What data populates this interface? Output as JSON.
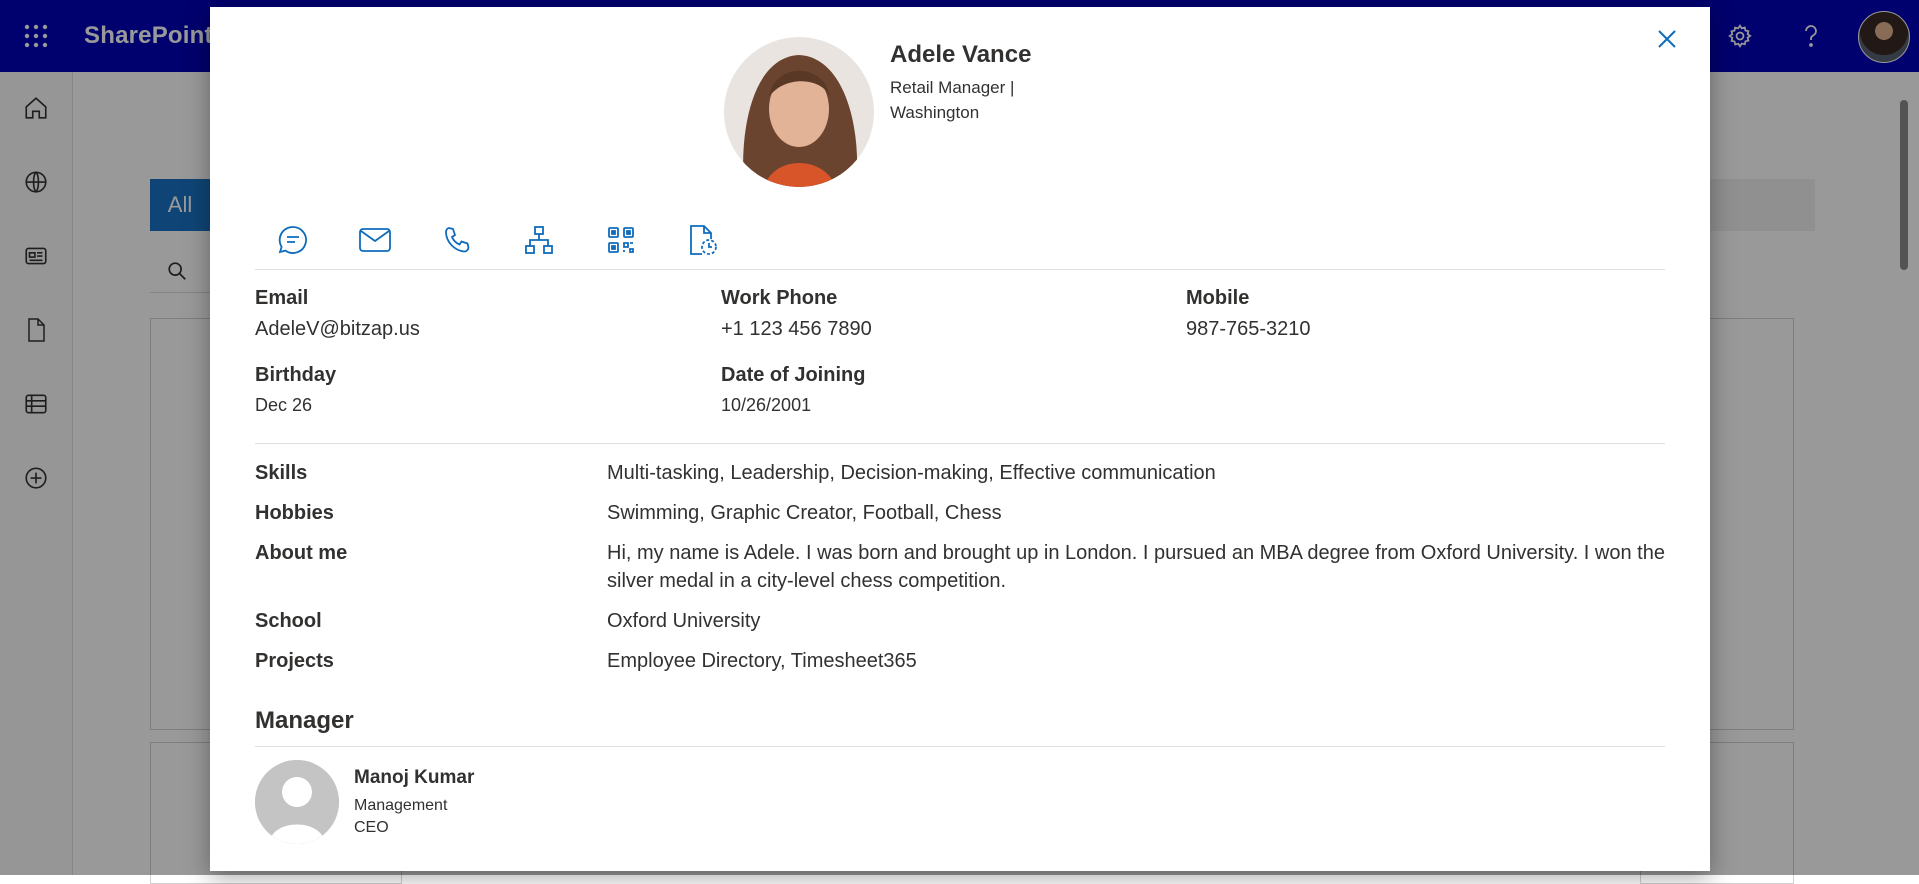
{
  "app": {
    "brand": "SharePoint",
    "tab_all": "All",
    "rail_icons": [
      "home-icon",
      "globe-icon",
      "news-icon",
      "document-icon",
      "list-icon",
      "add-icon"
    ],
    "top_icons": [
      "settings-icon",
      "help-icon"
    ]
  },
  "profile": {
    "name": "Adele Vance",
    "title_line1": "Retail Manager |",
    "title_line2": "Washington"
  },
  "actions": [
    "chat-icon",
    "mail-icon",
    "phone-icon",
    "org-chart-icon",
    "qr-code-icon",
    "timesheet-icon"
  ],
  "contact": {
    "email_label": "Email",
    "email_value": "AdeleV@bitzap.us",
    "work_phone_label": "Work Phone",
    "work_phone_value": "+1 123 456 7890",
    "mobile_label": "Mobile",
    "mobile_value": "987-765-3210",
    "birthday_label": "Birthday",
    "birthday_value": "Dec 26",
    "joining_label": "Date of Joining",
    "joining_value": "10/26/2001"
  },
  "details": {
    "skills_label": "Skills",
    "skills_value": "Multi-tasking, Leadership, Decision-making, Effective communication",
    "hobbies_label": "Hobbies",
    "hobbies_value": "Swimming, Graphic Creator, Football, Chess",
    "about_label": "About me",
    "about_value": "Hi, my name is Adele. I was born and brought up in London. I pursued an MBA degree from Oxford University. I won the silver medal in a city-level chess competition.",
    "school_label": "School",
    "school_value": "Oxford University",
    "projects_label": "Projects",
    "projects_value": "Employee Directory, Timesheet365"
  },
  "manager": {
    "section_title": "Manager",
    "name": "Manoj Kumar",
    "department": "Management",
    "role": "CEO"
  },
  "colors": {
    "topbar": "#0000b8",
    "accent": "#0f6cbd",
    "tab_all": "#1a73c5"
  }
}
